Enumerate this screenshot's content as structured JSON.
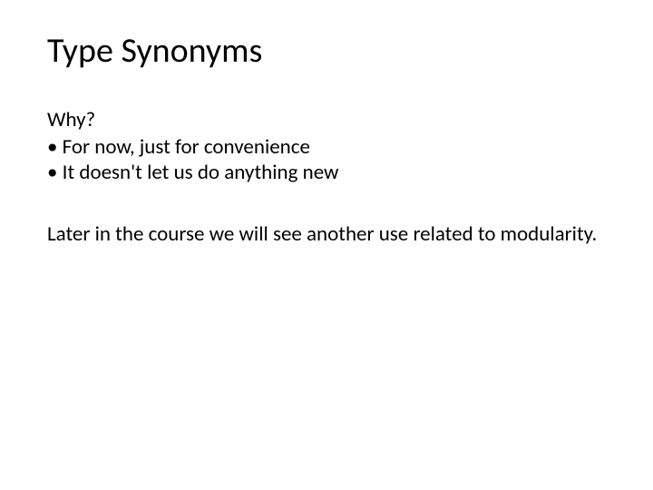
{
  "title": "Type Synonyms",
  "why_label": "Why?",
  "bullets": {
    "b1": "• For now, just for convenience",
    "b2": "• It doesn't let us do anything new"
  },
  "paragraph": "Later in the course we will see another use related to modularity."
}
